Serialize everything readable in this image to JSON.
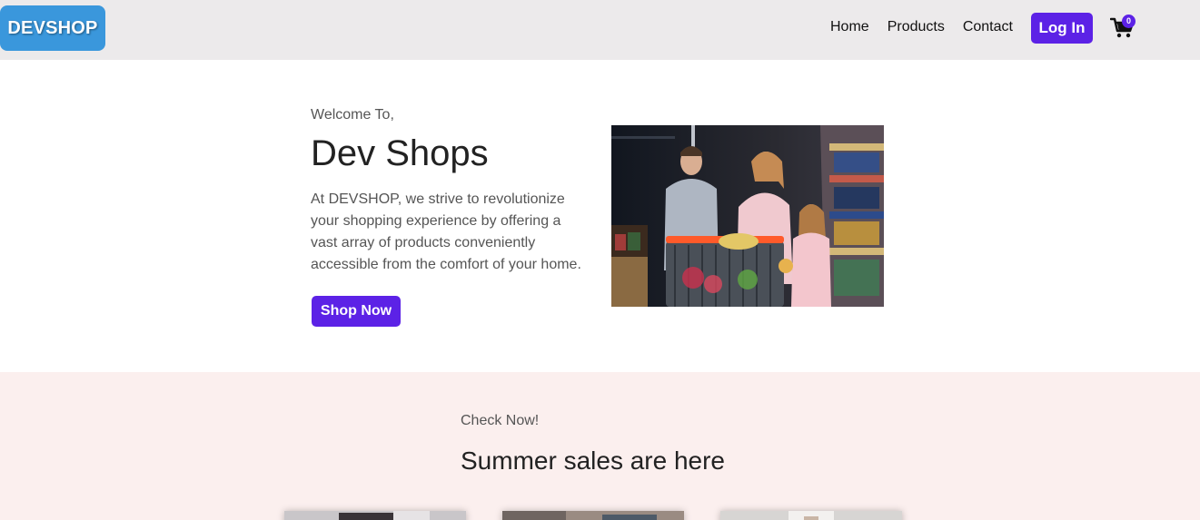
{
  "header": {
    "logo": "DEVSHOP",
    "nav": [
      "Home",
      "Products",
      "Contact"
    ],
    "login_label": "Log In",
    "cart_count": "0"
  },
  "hero": {
    "kicker": "Welcome To,",
    "title": "Dev Shops",
    "description": "At DEVSHOP, we strive to revolutionize your shopping experience by offering a vast array of products conveniently accessible from the comfort of your home.",
    "cta_label": "Shop Now",
    "image_icon": "family-shopping-photo"
  },
  "sales": {
    "kicker": "Check Now!",
    "title": "Summer sales are here",
    "cards": [
      "product-card-1",
      "product-card-2",
      "product-card-3"
    ]
  },
  "colors": {
    "brand_blue": "#3a97dc",
    "accent_purple": "#5c22e6",
    "nav_bg": "#eceaeb",
    "sales_bg": "#fbefee"
  }
}
